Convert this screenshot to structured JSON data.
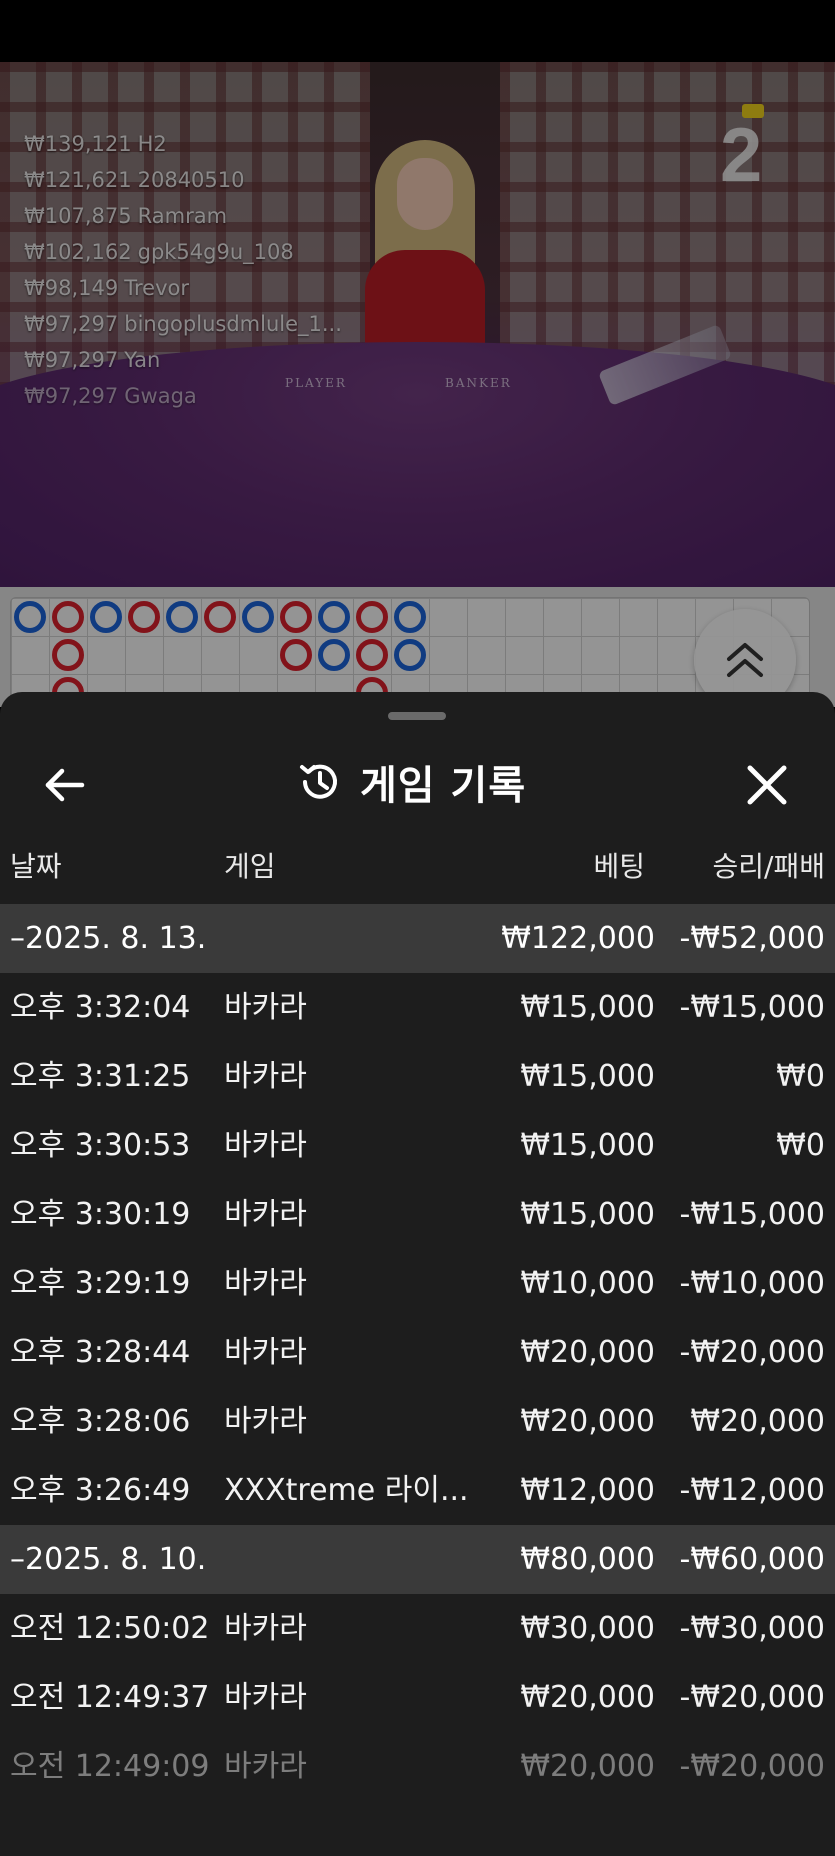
{
  "live_video": {
    "round_number": "2",
    "table_labels": {
      "player": "PLAYER",
      "banker": "BANKER"
    },
    "winners": [
      {
        "amount": "₩139,121",
        "name": "H2"
      },
      {
        "amount": "₩121,621",
        "name": "20840510"
      },
      {
        "amount": "₩107,875",
        "name": "Ramram"
      },
      {
        "amount": "₩102,162",
        "name": "gpk54g9u_108"
      },
      {
        "amount": "₩98,149",
        "name": "Trevor"
      },
      {
        "amount": "₩97,297",
        "name": "bingoplusdmlule_1..."
      },
      {
        "amount": "₩97,297",
        "name": "Yan"
      },
      {
        "amount": "₩97,297",
        "name": "Gwaga"
      }
    ]
  },
  "roadmap": {
    "scroll_up_icon": "double-chevron-up-icon",
    "colors": {
      "player": "#1a5fd0",
      "banker": "#d21f2a"
    }
  },
  "history_sheet": {
    "title": "게임 기록",
    "icons": {
      "back": "arrow-left-icon",
      "history": "history-clock-icon",
      "close": "close-icon"
    },
    "columns": {
      "date": "날짜",
      "game": "게임",
      "bet": "베팅",
      "win_loss": "승리/패배"
    },
    "groups": [
      {
        "date": "–2025. 8. 13.",
        "total_bet": "₩122,000",
        "total_result": "-₩52,000",
        "rows": [
          {
            "time": "오후 3:32:04",
            "game": "바카라",
            "bet": "₩15,000",
            "result": "-₩15,000"
          },
          {
            "time": "오후 3:31:25",
            "game": "바카라",
            "bet": "₩15,000",
            "result": "₩0"
          },
          {
            "time": "오후 3:30:53",
            "game": "바카라",
            "bet": "₩15,000",
            "result": "₩0"
          },
          {
            "time": "오후 3:30:19",
            "game": "바카라",
            "bet": "₩15,000",
            "result": "-₩15,000"
          },
          {
            "time": "오후 3:29:19",
            "game": "바카라",
            "bet": "₩10,000",
            "result": "-₩10,000"
          },
          {
            "time": "오후 3:28:44",
            "game": "바카라",
            "bet": "₩20,000",
            "result": "-₩20,000"
          },
          {
            "time": "오후 3:28:06",
            "game": "바카라",
            "bet": "₩20,000",
            "result": "₩20,000"
          },
          {
            "time": "오후 3:26:49",
            "game": "XXXtreme 라이...",
            "bet": "₩12,000",
            "result": "-₩12,000"
          }
        ]
      },
      {
        "date": "–2025. 8. 10.",
        "total_bet": "₩80,000",
        "total_result": "-₩60,000",
        "rows": [
          {
            "time": "오전 12:50:02",
            "game": "바카라",
            "bet": "₩30,000",
            "result": "-₩30,000"
          },
          {
            "time": "오전 12:49:37",
            "game": "바카라",
            "bet": "₩20,000",
            "result": "-₩20,000"
          },
          {
            "time": "오전 12:49:09",
            "game": "바카라",
            "bet": "₩20,000",
            "result": "-₩20,000"
          }
        ]
      }
    ]
  }
}
